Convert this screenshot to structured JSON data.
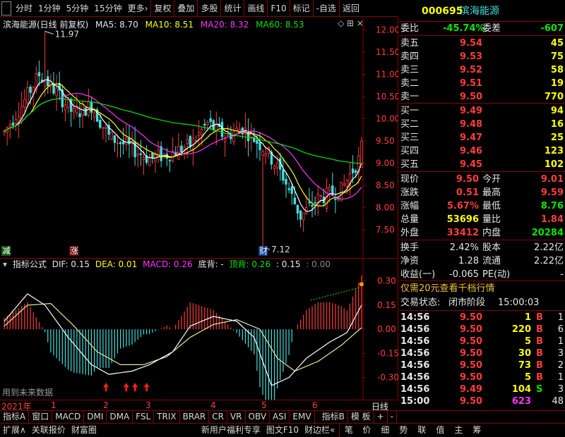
{
  "toolbar": {
    "first": "",
    "items": [
      "分时",
      "1分钟",
      "5分钟",
      "15分钟",
      "更多"
    ],
    "more_arrow": "›",
    "tools": [
      "复权",
      "叠加",
      "多股",
      "统计",
      "画线",
      "F10",
      "标记",
      "-自选",
      "返回"
    ]
  },
  "stock": {
    "code": "000695",
    "name": "滨海能源"
  },
  "main_legend": {
    "title": "滨海能源(日线 前复权)",
    "ma5": "MA5: 8.70",
    "ma10": "MA10: 8.51",
    "ma20": "MA20: 8.32",
    "ma60": "MA60: 8.53",
    "symbols": "◇ ⊞ ×"
  },
  "main_axis": {
    "ticks": [
      "12.00",
      "11.50",
      "11.00",
      "10.50",
      "10.00",
      "9.50",
      "9.00",
      "8.50",
      "8.00",
      "7.50"
    ]
  },
  "annotations": {
    "high": "11.97",
    "low": "7.12",
    "tag_jian": "减",
    "tag_zhang": "涨",
    "tag_cai": "财"
  },
  "indicator": {
    "name": "指标公式",
    "dif": "DIF: 0.15",
    "dea": "DEA: 0.01",
    "macd": "MACD: 0.26",
    "dibei": "底背: -",
    "dingbei": "顶背: 0.26",
    "v1": ": 0.15",
    "v2": ": 0.00",
    "ticks": [
      "0.30",
      "0.15",
      "0.00",
      "-0.15",
      "-0.30"
    ],
    "footnote": "用到未来数据"
  },
  "date_row": {
    "year": "2021年",
    "months": [
      "1",
      "2",
      "3",
      "4",
      "5",
      "6"
    ],
    "right_label": "日线"
  },
  "tabs": [
    "指标A",
    "窗口",
    "MACD",
    "DMI",
    "DMA",
    "FSL",
    "TRIX",
    "BRAR",
    "CR",
    "VR",
    "OBV",
    "ASI",
    "EMV",
    "指标B",
    "模 板",
    "+",
    "-"
  ],
  "status": {
    "left": [
      "扩展∧",
      "关联报价",
      "财富圈"
    ],
    "right": [
      "新用户福利专享",
      "图文F10",
      "财边栏«"
    ],
    "buttons": [
      "笔",
      "价",
      "细",
      "势",
      "联",
      "值",
      "主",
      "筹"
    ]
  },
  "quote": {
    "weibi_label": "委比",
    "weibi": "-45.74%",
    "weicha_label": "委差",
    "weicha": "-607",
    "asks": [
      {
        "label": "卖五",
        "price": "9.54",
        "vol": "45"
      },
      {
        "label": "卖四",
        "price": "9.53",
        "vol": "75"
      },
      {
        "label": "卖三",
        "price": "9.52",
        "vol": "58"
      },
      {
        "label": "卖二",
        "price": "9.51",
        "vol": "19"
      },
      {
        "label": "卖一",
        "price": "9.50",
        "vol": "770"
      }
    ],
    "bids": [
      {
        "label": "买一",
        "price": "9.49",
        "vol": "94"
      },
      {
        "label": "买二",
        "price": "9.48",
        "vol": "16"
      },
      {
        "label": "买三",
        "price": "9.47",
        "vol": "25"
      },
      {
        "label": "买四",
        "price": "9.46",
        "vol": "123"
      },
      {
        "label": "买五",
        "price": "9.45",
        "vol": "102"
      }
    ],
    "stats": [
      {
        "l1": "现价",
        "v1": "9.50",
        "c1": "red",
        "l2": "今开",
        "v2": "9.01",
        "c2": "red"
      },
      {
        "l1": "涨跌",
        "v1": "0.51",
        "c1": "red",
        "l2": "最高",
        "v2": "9.59",
        "c2": "red"
      },
      {
        "l1": "涨幅",
        "v1": "5.67%",
        "c1": "red",
        "l2": "最低",
        "v2": "8.76",
        "c2": "green"
      },
      {
        "l1": "总量",
        "v1": "53696",
        "c1": "yellow",
        "l2": "量比",
        "v2": "1.84",
        "c2": "red"
      },
      {
        "l1": "外盘",
        "v1": "33412",
        "c1": "red",
        "l2": "内盘",
        "v2": "20284",
        "c2": "green"
      }
    ],
    "stats2": [
      {
        "l1": "换手",
        "v1": "2.42%",
        "l2": "股本",
        "v2": "2.22亿"
      },
      {
        "l1": "净资",
        "v1": "1.28",
        "l2": "流通",
        "v2": "2.22亿"
      },
      {
        "l1": "收益(一)",
        "v1": "-0.065",
        "l2": "PE(动)",
        "v2": "-"
      }
    ],
    "promo": "仅需20元查看千档行情",
    "trade_status_label": "交易状态:",
    "trade_status": "闭市阶段",
    "trade_time": "15:00:03",
    "ticks": [
      {
        "time": "14:56",
        "price": "9.50",
        "pc": "red",
        "vol": "1",
        "vc": "yellow",
        "side": "B",
        "sc": "red",
        "n": "1"
      },
      {
        "time": "14:56",
        "price": "9.50",
        "pc": "red",
        "vol": "220",
        "vc": "yellow",
        "side": "B",
        "sc": "red",
        "n": "6"
      },
      {
        "time": "14:56",
        "price": "9.50",
        "pc": "red",
        "vol": "5",
        "vc": "yellow",
        "side": "B",
        "sc": "red",
        "n": "1"
      },
      {
        "time": "14:56",
        "price": "9.50",
        "pc": "red",
        "vol": "30",
        "vc": "yellow",
        "side": "B",
        "sc": "red",
        "n": "3"
      },
      {
        "time": "14:56",
        "price": "9.50",
        "pc": "red",
        "vol": "73",
        "vc": "yellow",
        "side": "B",
        "sc": "red",
        "n": "2"
      },
      {
        "time": "14:56",
        "price": "9.50",
        "pc": "red",
        "vol": "5",
        "vc": "yellow",
        "side": "B",
        "sc": "red",
        "n": "1"
      },
      {
        "time": "14:56",
        "price": "9.49",
        "pc": "red",
        "vol": "104",
        "vc": "yellow",
        "side": "S",
        "sc": "green",
        "n": "3"
      },
      {
        "time": "15:00",
        "price": "9.50",
        "pc": "red",
        "vol": "623",
        "vc": "purple",
        "side": "",
        "sc": "red",
        "n": "48"
      }
    ]
  },
  "colors": {
    "up": "#ff3c3c",
    "down": "#40e0e0",
    "ma5": "#ffffff",
    "ma10": "#ffff00",
    "ma20": "#ff33ff",
    "ma60": "#00e600",
    "frame": "#8a0000"
  }
}
